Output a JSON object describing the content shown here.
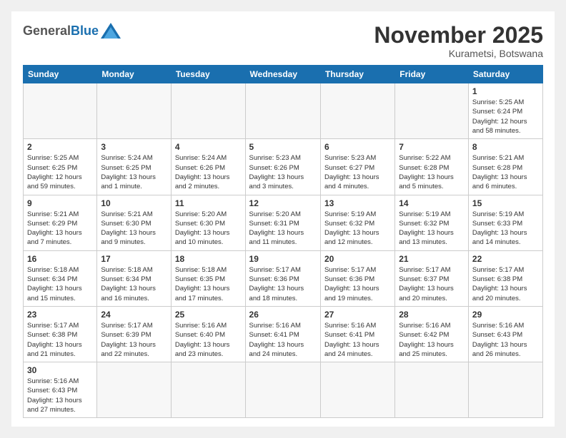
{
  "header": {
    "logo_general": "General",
    "logo_blue": "Blue",
    "month_title": "November 2025",
    "location": "Kurametsi, Botswana"
  },
  "weekdays": [
    "Sunday",
    "Monday",
    "Tuesday",
    "Wednesday",
    "Thursday",
    "Friday",
    "Saturday"
  ],
  "weeks": [
    [
      {
        "day": "",
        "info": ""
      },
      {
        "day": "",
        "info": ""
      },
      {
        "day": "",
        "info": ""
      },
      {
        "day": "",
        "info": ""
      },
      {
        "day": "",
        "info": ""
      },
      {
        "day": "",
        "info": ""
      },
      {
        "day": "1",
        "info": "Sunrise: 5:25 AM\nSunset: 6:24 PM\nDaylight: 12 hours\nand 58 minutes."
      }
    ],
    [
      {
        "day": "2",
        "info": "Sunrise: 5:25 AM\nSunset: 6:25 PM\nDaylight: 12 hours\nand 59 minutes."
      },
      {
        "day": "3",
        "info": "Sunrise: 5:24 AM\nSunset: 6:25 PM\nDaylight: 13 hours\nand 1 minute."
      },
      {
        "day": "4",
        "info": "Sunrise: 5:24 AM\nSunset: 6:26 PM\nDaylight: 13 hours\nand 2 minutes."
      },
      {
        "day": "5",
        "info": "Sunrise: 5:23 AM\nSunset: 6:26 PM\nDaylight: 13 hours\nand 3 minutes."
      },
      {
        "day": "6",
        "info": "Sunrise: 5:23 AM\nSunset: 6:27 PM\nDaylight: 13 hours\nand 4 minutes."
      },
      {
        "day": "7",
        "info": "Sunrise: 5:22 AM\nSunset: 6:28 PM\nDaylight: 13 hours\nand 5 minutes."
      },
      {
        "day": "8",
        "info": "Sunrise: 5:21 AM\nSunset: 6:28 PM\nDaylight: 13 hours\nand 6 minutes."
      }
    ],
    [
      {
        "day": "9",
        "info": "Sunrise: 5:21 AM\nSunset: 6:29 PM\nDaylight: 13 hours\nand 7 minutes."
      },
      {
        "day": "10",
        "info": "Sunrise: 5:21 AM\nSunset: 6:30 PM\nDaylight: 13 hours\nand 9 minutes."
      },
      {
        "day": "11",
        "info": "Sunrise: 5:20 AM\nSunset: 6:30 PM\nDaylight: 13 hours\nand 10 minutes."
      },
      {
        "day": "12",
        "info": "Sunrise: 5:20 AM\nSunset: 6:31 PM\nDaylight: 13 hours\nand 11 minutes."
      },
      {
        "day": "13",
        "info": "Sunrise: 5:19 AM\nSunset: 6:32 PM\nDaylight: 13 hours\nand 12 minutes."
      },
      {
        "day": "14",
        "info": "Sunrise: 5:19 AM\nSunset: 6:32 PM\nDaylight: 13 hours\nand 13 minutes."
      },
      {
        "day": "15",
        "info": "Sunrise: 5:19 AM\nSunset: 6:33 PM\nDaylight: 13 hours\nand 14 minutes."
      }
    ],
    [
      {
        "day": "16",
        "info": "Sunrise: 5:18 AM\nSunset: 6:34 PM\nDaylight: 13 hours\nand 15 minutes."
      },
      {
        "day": "17",
        "info": "Sunrise: 5:18 AM\nSunset: 6:34 PM\nDaylight: 13 hours\nand 16 minutes."
      },
      {
        "day": "18",
        "info": "Sunrise: 5:18 AM\nSunset: 6:35 PM\nDaylight: 13 hours\nand 17 minutes."
      },
      {
        "day": "19",
        "info": "Sunrise: 5:17 AM\nSunset: 6:36 PM\nDaylight: 13 hours\nand 18 minutes."
      },
      {
        "day": "20",
        "info": "Sunrise: 5:17 AM\nSunset: 6:36 PM\nDaylight: 13 hours\nand 19 minutes."
      },
      {
        "day": "21",
        "info": "Sunrise: 5:17 AM\nSunset: 6:37 PM\nDaylight: 13 hours\nand 20 minutes."
      },
      {
        "day": "22",
        "info": "Sunrise: 5:17 AM\nSunset: 6:38 PM\nDaylight: 13 hours\nand 20 minutes."
      }
    ],
    [
      {
        "day": "23",
        "info": "Sunrise: 5:17 AM\nSunset: 6:38 PM\nDaylight: 13 hours\nand 21 minutes."
      },
      {
        "day": "24",
        "info": "Sunrise: 5:17 AM\nSunset: 6:39 PM\nDaylight: 13 hours\nand 22 minutes."
      },
      {
        "day": "25",
        "info": "Sunrise: 5:16 AM\nSunset: 6:40 PM\nDaylight: 13 hours\nand 23 minutes."
      },
      {
        "day": "26",
        "info": "Sunrise: 5:16 AM\nSunset: 6:41 PM\nDaylight: 13 hours\nand 24 minutes."
      },
      {
        "day": "27",
        "info": "Sunrise: 5:16 AM\nSunset: 6:41 PM\nDaylight: 13 hours\nand 24 minutes."
      },
      {
        "day": "28",
        "info": "Sunrise: 5:16 AM\nSunset: 6:42 PM\nDaylight: 13 hours\nand 25 minutes."
      },
      {
        "day": "29",
        "info": "Sunrise: 5:16 AM\nSunset: 6:43 PM\nDaylight: 13 hours\nand 26 minutes."
      }
    ],
    [
      {
        "day": "30",
        "info": "Sunrise: 5:16 AM\nSunset: 6:43 PM\nDaylight: 13 hours\nand 27 minutes."
      },
      {
        "day": "",
        "info": ""
      },
      {
        "day": "",
        "info": ""
      },
      {
        "day": "",
        "info": ""
      },
      {
        "day": "",
        "info": ""
      },
      {
        "day": "",
        "info": ""
      },
      {
        "day": "",
        "info": ""
      }
    ]
  ]
}
